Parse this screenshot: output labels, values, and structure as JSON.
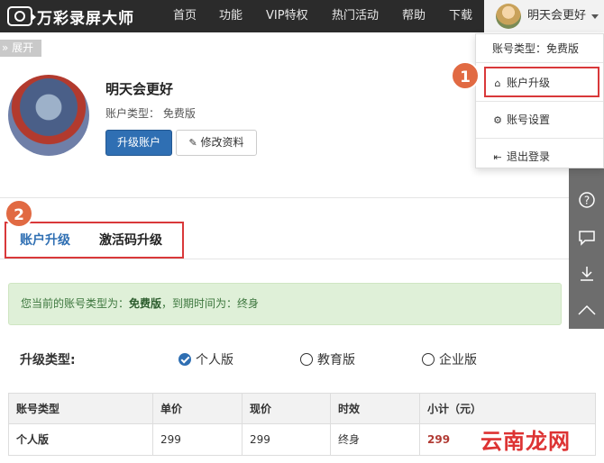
{
  "brand": {
    "name": "万彩录屏大师"
  },
  "nav": [
    "首页",
    "功能",
    "VIP特权",
    "热门活动",
    "帮助",
    "下载"
  ],
  "user_menu": {
    "name": "明天会更好"
  },
  "expand_tag": "» 展开",
  "profile": {
    "name": "明天会更好",
    "type_label": "账户类型：",
    "type_value": "免费版",
    "upgrade_button": "升级账户",
    "edit_button": "修改资料"
  },
  "dropdown": {
    "account_type_label": "账号类型：",
    "account_type_value": "免费版",
    "items": [
      "账户升级",
      "账号设置",
      "退出登录"
    ]
  },
  "badges": [
    "1",
    "2"
  ],
  "tabs": [
    "账户升级",
    "激活码升级"
  ],
  "alert": {
    "prefix": "您当前的账号类型为：",
    "type": "免费版",
    "middle": "，到期时间为：",
    "expiry": "终身"
  },
  "upgrade": {
    "label": "升级类型:",
    "options": [
      "个人版",
      "教育版",
      "企业版"
    ],
    "selected": "个人版"
  },
  "table": {
    "headers": [
      "账号类型",
      "单价",
      "现价",
      "时效",
      "小计（元）"
    ],
    "rows": [
      [
        "个人版",
        "299",
        "299",
        "终身",
        "299"
      ]
    ]
  },
  "watermark": "云南龙网",
  "colors": {
    "accent": "#2f6fb3",
    "annotation": "#d9383a",
    "badge": "#e16a43"
  }
}
